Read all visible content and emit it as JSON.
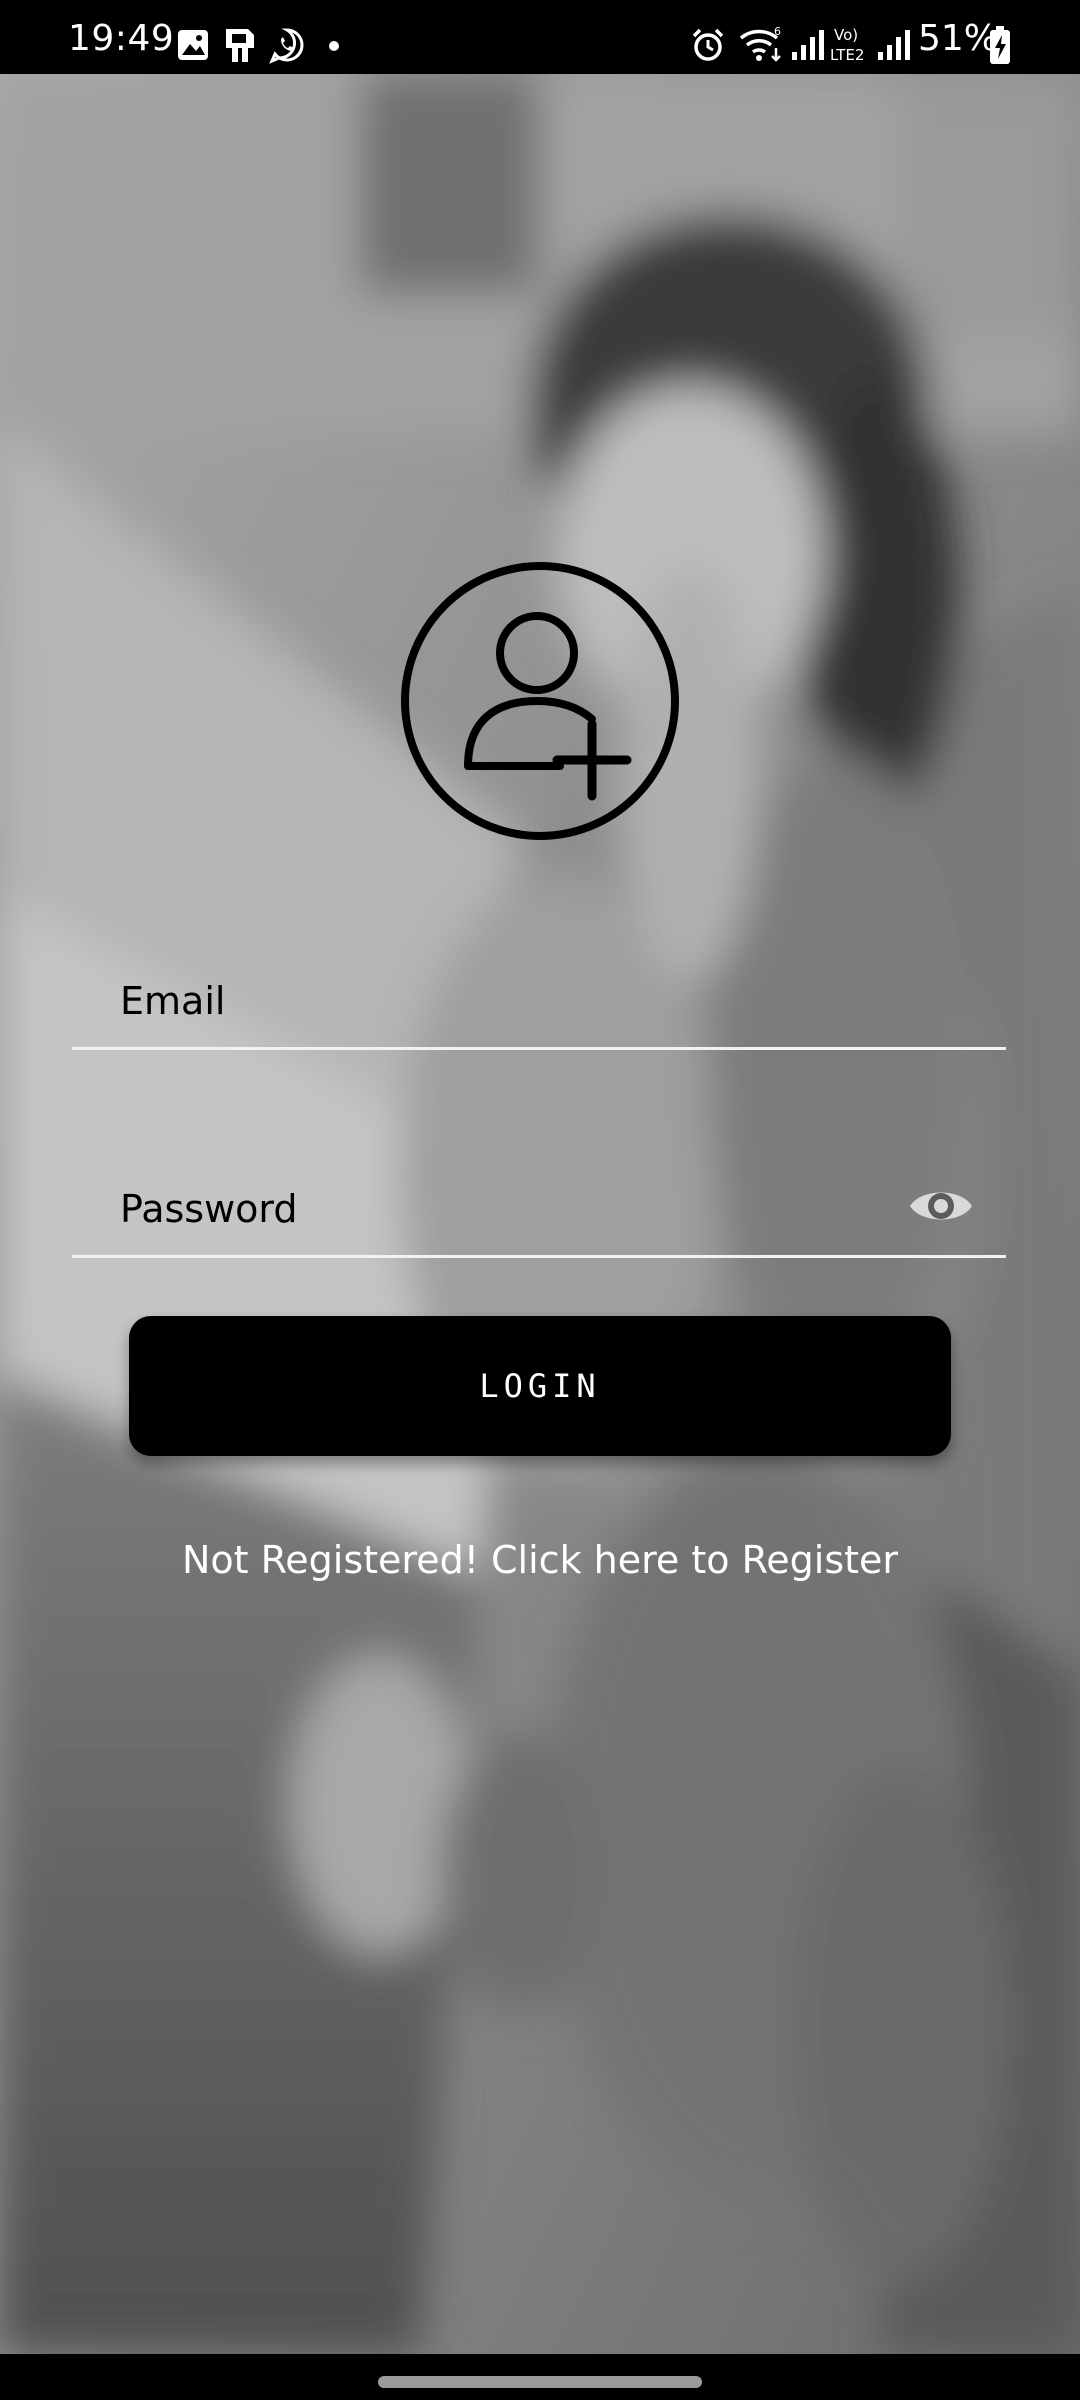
{
  "status_bar": {
    "time": "19:49",
    "battery_percent": "51%",
    "icons": [
      "gallery-icon",
      "sim-card-icon",
      "whatsapp-icon",
      "notification-dot-icon",
      "alarm-icon",
      "wifi-icon",
      "signal-icon",
      "volte-icon",
      "signal-icon",
      "battery-charging-icon"
    ]
  },
  "login": {
    "avatar_icon": "add-user-icon",
    "email": {
      "placeholder": "Email",
      "value": ""
    },
    "password": {
      "placeholder": "Password",
      "value": "",
      "toggle_icon": "eye-icon"
    },
    "login_button_label": "LOGIN",
    "register_link": "Not Registered! Click here to Register"
  },
  "colors": {
    "button_bg": "#000000",
    "button_text": "#ffffff",
    "field_underline": "#f2f2f2",
    "link_text": "#ffffff"
  }
}
